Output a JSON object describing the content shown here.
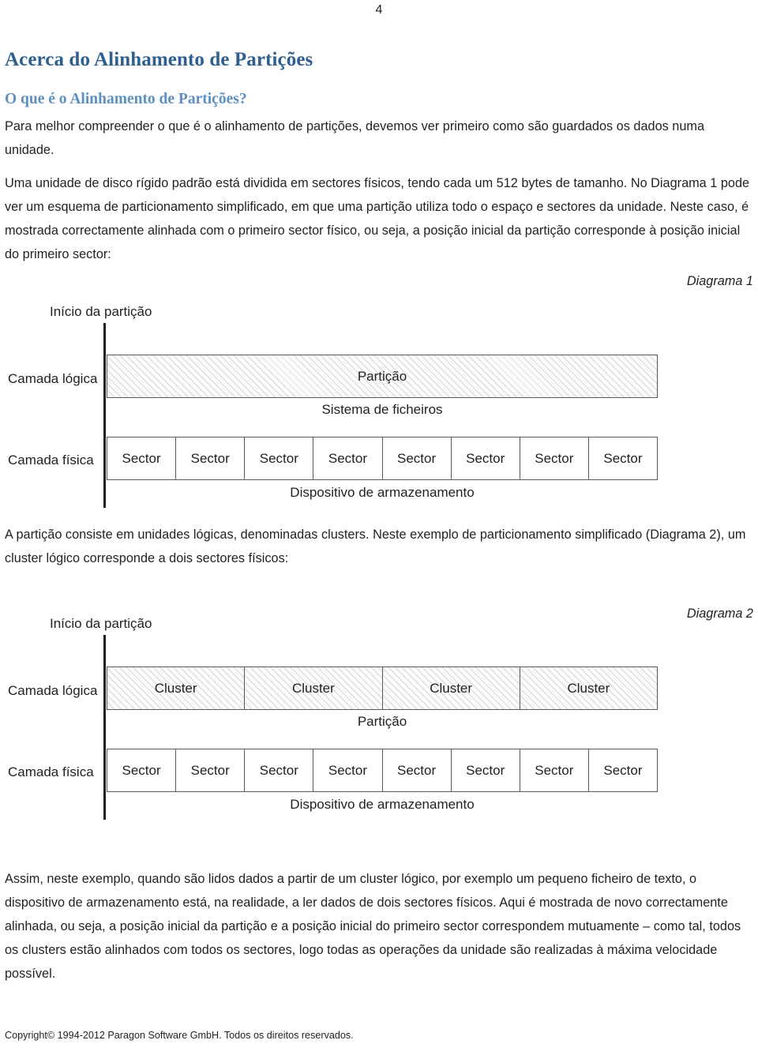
{
  "page": {
    "number": "4"
  },
  "headings": {
    "title": "Acerca do Alinhamento de Partições",
    "subtitle": "O que é o Alinhamento de Partições?"
  },
  "paragraphs": {
    "intro": "Para melhor compreender o que é o alinhamento de partições, devemos ver primeiro como são guardados os dados numa unidade.",
    "sectors": "Uma unidade de disco rígido padrão está dividida em sectores físicos, tendo cada um 512 bytes de tamanho. No Diagrama 1 pode ver um esquema de particionamento simplificado, em que uma partição utiliza todo o espaço e sectores da unidade. Neste caso, é mostrada correctamente alinhada com o primeiro sector físico, ou seja, a posição inicial da partição corresponde à posição inicial do primeiro sector:",
    "cluster": "A partição consiste em unidades lógicas, denominadas clusters. Neste exemplo de particionamento simplificado (Diagrama 2), um cluster lógico corresponde a dois sectores físicos:",
    "final": "Assim, neste exemplo, quando são lidos dados a partir de um cluster lógico, por exemplo um pequeno ficheiro de texto, o dispositivo de armazenamento está, na realidade, a ler dados de dois sectores físicos. Aqui é mostrada de novo correctamente alinhada, ou seja, a posição inicial da partição e a posição inicial do primeiro sector correspondem mutuamente – como tal, todos os clusters estão alinhados com todos os sectores, logo todas as operações da unidade são realizadas à máxima velocidade possível."
  },
  "diagram1": {
    "caption": "Diagrama 1",
    "start_label": "Início da partição",
    "logical_layer_label": "Camada lógica",
    "physical_layer_label": "Camada física",
    "partition_label": "Partição",
    "filesystem_label": "Sistema de ficheiros",
    "device_label": "Dispositivo de armazenamento",
    "sectors": [
      "Sector",
      "Sector",
      "Sector",
      "Sector",
      "Sector",
      "Sector",
      "Sector",
      "Sector"
    ]
  },
  "diagram2": {
    "caption": "Diagrama 2",
    "start_label": "Início da partição",
    "logical_layer_label": "Camada lógica",
    "physical_layer_label": "Camada física",
    "partition_label": "Partição",
    "device_label": "Dispositivo de armazenamento",
    "clusters": [
      "Cluster",
      "Cluster",
      "Cluster",
      "Cluster"
    ],
    "sectors": [
      "Sector",
      "Sector",
      "Sector",
      "Sector",
      "Sector",
      "Sector",
      "Sector",
      "Sector"
    ]
  },
  "footer": {
    "copyright": "Copyright© 1994-2012 Paragon Software GmbH. Todos os direitos reservados."
  },
  "colors": {
    "heading_primary": "#2E5F8F",
    "heading_secondary": "#5D90BF",
    "body_text": "#231F20",
    "box_border": "#5A5A5A"
  }
}
